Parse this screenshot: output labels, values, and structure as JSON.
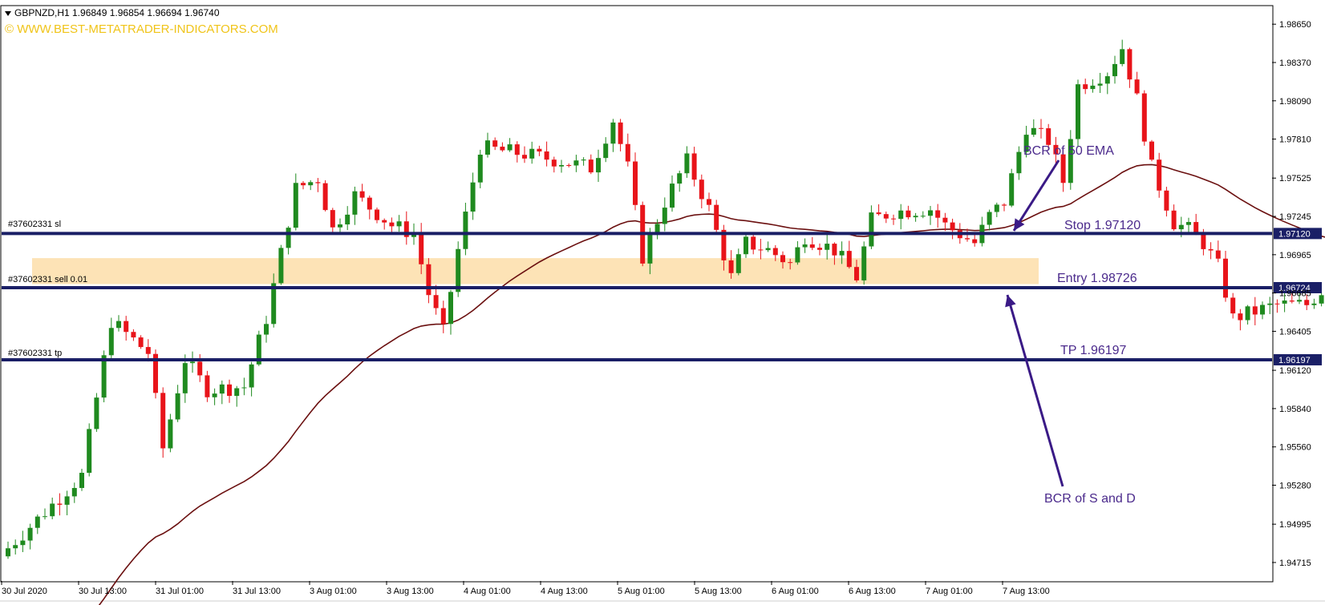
{
  "header": {
    "symbol_info": "GBPNZD,H1  1.96849 1.96854 1.96694 1.96740",
    "watermark": "© WWW.BEST-METATRADER-INDICATORS.COM"
  },
  "annotations": {
    "ema_label": "BCR of 50 EMA",
    "sd_label": "BCR of S and D",
    "stop_label": "Stop 1.97120",
    "entry_label": "Entry 1.98726",
    "tp_label": "TP 1.96197"
  },
  "order_tags": {
    "sl": "#37602331 sl",
    "sell": "#37602331 sell 0.01",
    "tp": "#37602331 tp"
  },
  "colors": {
    "bull": "#1f8a1f",
    "bear": "#e8141a",
    "ema": "#6b1010",
    "level_line": "#1a1f66",
    "zone": "#fde3b6",
    "arrow": "#3a1a86",
    "annotation": "#4b2a8c",
    "watermark": "#f0c419"
  },
  "chart_data": {
    "type": "candlestick",
    "symbol": "GBPNZD",
    "timeframe": "H1",
    "y_range": [
      1.9458,
      1.9878
    ],
    "y_ticks": [
      "1.98650",
      "1.98370",
      "1.98090",
      "1.97810",
      "1.97525",
      "1.97245",
      "1.96965",
      "1.96685",
      "1.96405",
      "1.96120",
      "1.95840",
      "1.95560",
      "1.95280",
      "1.94995",
      "1.94715"
    ],
    "x_ticks": [
      "30 Jul 2020",
      "30 Jul 13:00",
      "31 Jul 01:00",
      "31 Jul 13:00",
      "3 Aug 01:00",
      "3 Aug 13:00",
      "4 Aug 01:00",
      "4 Aug 13:00",
      "5 Aug 01:00",
      "5 Aug 13:00",
      "6 Aug 01:00",
      "6 Aug 13:00",
      "7 Aug 01:00",
      "7 Aug 13:00"
    ],
    "levels": [
      {
        "name": "sl",
        "price": 1.9712,
        "label": "1.97120"
      },
      {
        "name": "entry",
        "price": 1.96724,
        "label": "1.96724"
      },
      {
        "name": "tp",
        "price": 1.96197,
        "label": "1.96197"
      }
    ],
    "zone": {
      "top": 1.9694,
      "bottom": 1.9675
    },
    "ema_period": 50,
    "anchors": [
      [
        0,
        1.9482
      ],
      [
        10,
        1.9535
      ],
      [
        14,
        1.9648
      ],
      [
        19,
        1.9625
      ],
      [
        21,
        1.9555
      ],
      [
        24,
        1.962
      ],
      [
        27,
        1.9598
      ],
      [
        32,
        1.96
      ],
      [
        35,
        1.965
      ],
      [
        39,
        1.9745
      ],
      [
        42,
        1.9752
      ],
      [
        44,
        1.9715
      ],
      [
        47,
        1.974
      ],
      [
        52,
        1.9718
      ],
      [
        55,
        1.9712
      ],
      [
        57,
        1.9668
      ],
      [
        59,
        1.964
      ],
      [
        61,
        1.97
      ],
      [
        64,
        1.9775
      ],
      [
        70,
        1.977
      ],
      [
        75,
        1.9765
      ],
      [
        79,
        1.976
      ],
      [
        82,
        1.9795
      ],
      [
        84,
        1.976
      ],
      [
        86,
        1.9695
      ],
      [
        89,
        1.9735
      ],
      [
        92,
        1.9765
      ],
      [
        95,
        1.973
      ],
      [
        98,
        1.968
      ],
      [
        100,
        1.9705
      ],
      [
        103,
        1.97
      ],
      [
        106,
        1.969
      ],
      [
        108,
        1.971
      ],
      [
        112,
        1.97
      ],
      [
        115,
        1.968
      ],
      [
        117,
        1.9722
      ],
      [
        120,
        1.9728
      ],
      [
        125,
        1.973
      ],
      [
        127,
        1.9718
      ],
      [
        131,
        1.9705
      ],
      [
        133,
        1.9725
      ],
      [
        135,
        1.9735
      ],
      [
        138,
        1.979
      ],
      [
        141,
        1.978
      ],
      [
        143,
        1.975
      ],
      [
        145,
        1.982
      ],
      [
        149,
        1.983
      ],
      [
        151,
        1.9848
      ],
      [
        153,
        1.981
      ],
      [
        155,
        1.976
      ],
      [
        158,
        1.972
      ],
      [
        160,
        1.9715
      ],
      [
        162,
        1.9705
      ],
      [
        164,
        1.9688
      ],
      [
        166,
        1.965
      ],
      [
        169,
        1.9655
      ],
      [
        172,
        1.966
      ],
      [
        176,
        1.966
      ],
      [
        179,
        1.9675
      ],
      [
        181,
        1.969
      ],
      [
        183,
        1.9685
      ],
      [
        184,
        1.9674
      ]
    ]
  }
}
